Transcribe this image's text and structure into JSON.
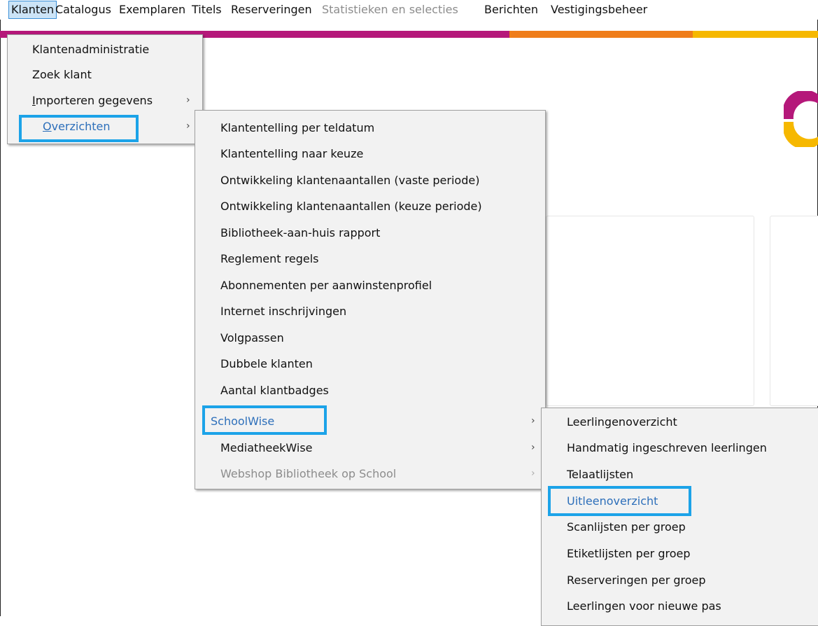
{
  "menubar": {
    "items": [
      {
        "label": "Klanten"
      },
      {
        "label": "Catalogus"
      },
      {
        "label": "Exemplaren"
      },
      {
        "label": "Titels"
      },
      {
        "label": "Reserveringen"
      },
      {
        "label": "Statistieken en selecties"
      },
      {
        "label": "Berichten"
      },
      {
        "label": "Vestigingsbeheer"
      }
    ]
  },
  "menu_klanten": {
    "items": [
      {
        "label": "Klantenadministratie"
      },
      {
        "label": "Zoek klant"
      },
      {
        "label_mn": "I",
        "label_rest": "mporteren gegevens"
      },
      {
        "label_mn": "O",
        "label_rest": "verzichten"
      }
    ]
  },
  "menu_overzichten": {
    "items": [
      {
        "label": "Klantentelling per teldatum"
      },
      {
        "label": "Klantentelling naar keuze"
      },
      {
        "label": "Ontwikkeling klantenaantallen (vaste periode)"
      },
      {
        "label": "Ontwikkeling klantenaantallen (keuze periode)"
      },
      {
        "label": "Bibliotheek-aan-huis rapport"
      },
      {
        "label": "Reglement regels"
      },
      {
        "label": "Abonnementen per aanwinstenprofiel"
      },
      {
        "label": "Internet inschrijvingen"
      },
      {
        "label": "Volgpassen"
      },
      {
        "label": "Dubbele klanten"
      },
      {
        "label": "Aantal klantbadges"
      },
      {
        "label": "SchoolWise"
      },
      {
        "label": "MediatheekWise"
      },
      {
        "label": "Webshop Bibliotheek op School"
      }
    ]
  },
  "menu_schoolwise": {
    "items": [
      {
        "label": "Leerlingenoverzicht"
      },
      {
        "label": "Handmatig ingeschreven leerlingen"
      },
      {
        "label": "Telaatlijsten"
      },
      {
        "label": "Uitleenoverzicht"
      },
      {
        "label": "Scanlijsten per groep"
      },
      {
        "label": "Etiketlijsten per groep"
      },
      {
        "label": "Reserveringen per groep"
      },
      {
        "label": "Leerlingen voor nieuwe pas"
      }
    ]
  },
  "chevron": "›",
  "colors": {
    "highlight": "#1ca3e8",
    "selected_text": "#2d6fba",
    "brand_magenta": "#b5187a",
    "brand_orange": "#ef7d1a",
    "brand_yellow": "#f6b800"
  }
}
